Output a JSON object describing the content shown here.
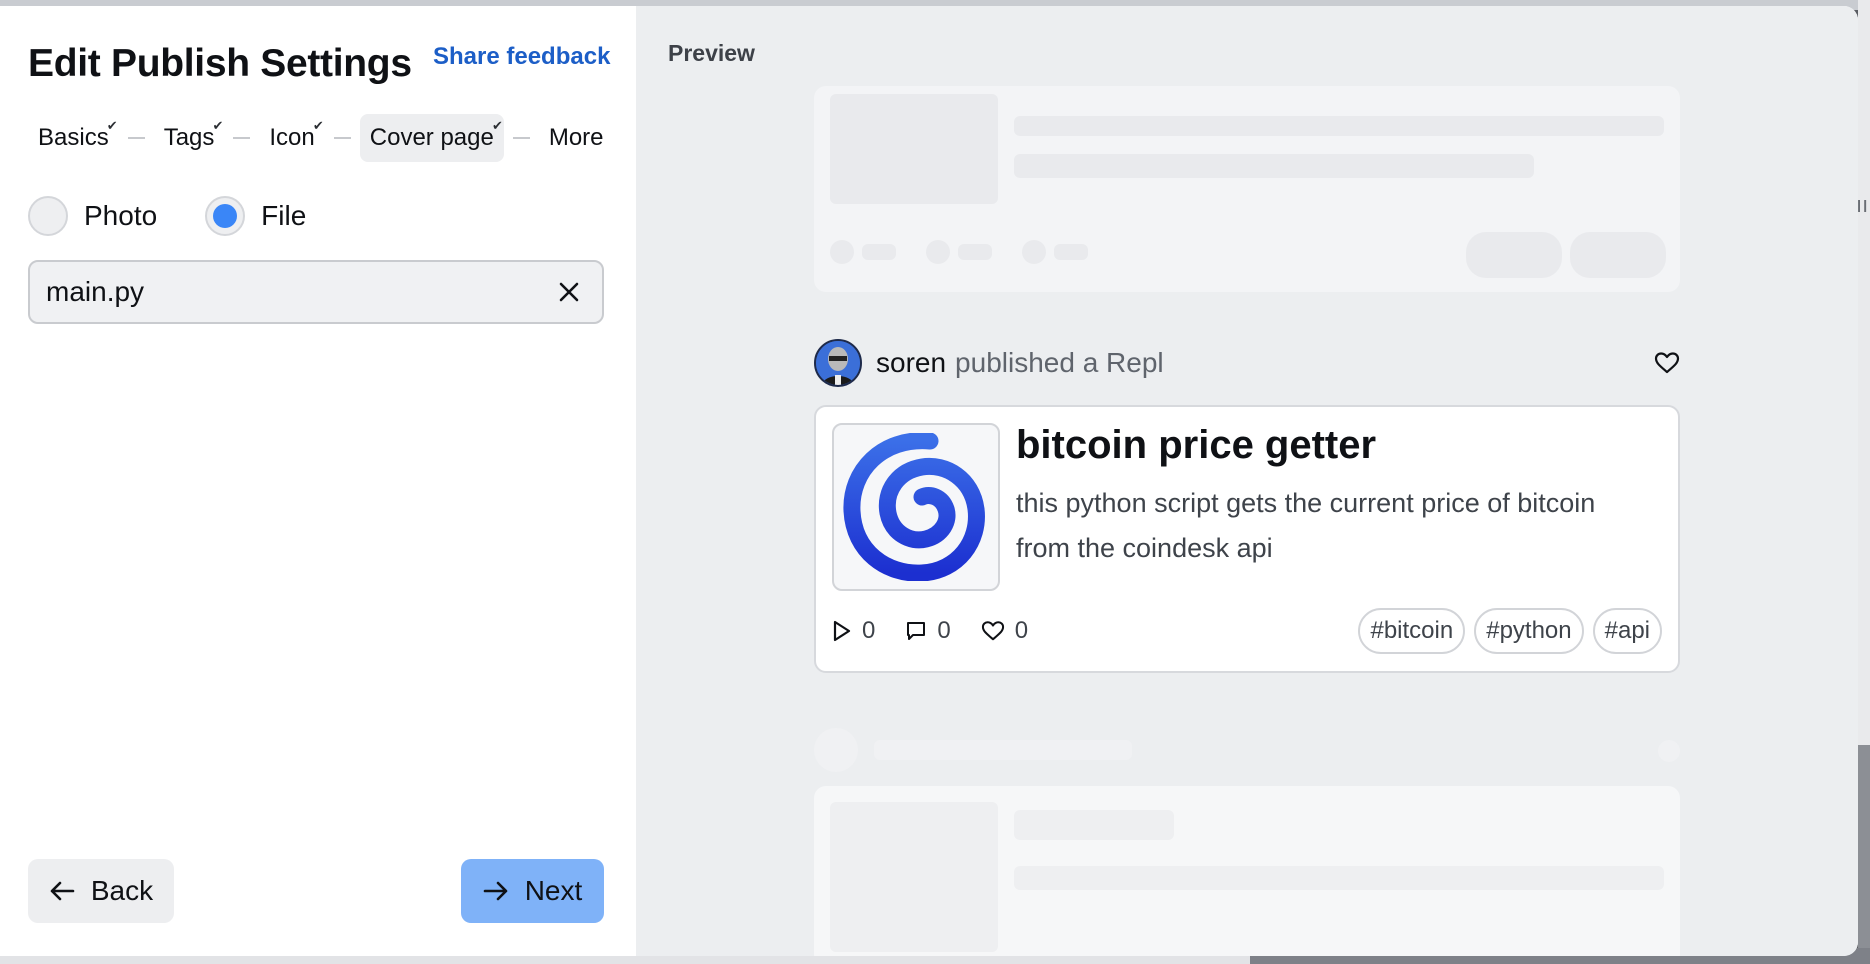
{
  "modal": {
    "title": "Edit Publish Settings",
    "feedback_link": "Share feedback"
  },
  "steps": [
    {
      "label": "Basics",
      "completed": true,
      "active": false
    },
    {
      "label": "Tags",
      "completed": true,
      "active": false
    },
    {
      "label": "Icon",
      "completed": true,
      "active": false
    },
    {
      "label": "Cover page",
      "completed": true,
      "active": true
    },
    {
      "label": "More",
      "completed": false,
      "active": false
    }
  ],
  "cover_source": {
    "options": [
      {
        "label": "Photo",
        "selected": false
      },
      {
        "label": "File",
        "selected": true
      }
    ],
    "file_value": "main.py"
  },
  "footer": {
    "back_label": "Back",
    "next_label": "Next"
  },
  "preview": {
    "label": "Preview",
    "post": {
      "author": "soren",
      "action": "published a Repl",
      "title": "bitcoin price getter",
      "description": "this python script gets the current price of bitcoin from the coindesk api",
      "runs": "0",
      "comments": "0",
      "likes": "0",
      "tags": [
        "#bitcoin",
        "#python",
        "#api"
      ]
    }
  },
  "colors": {
    "accent": "#3a86f7",
    "link": "#1c5ec7",
    "next_button": "#7fb2f8",
    "preview_bg": "#eceef0"
  }
}
